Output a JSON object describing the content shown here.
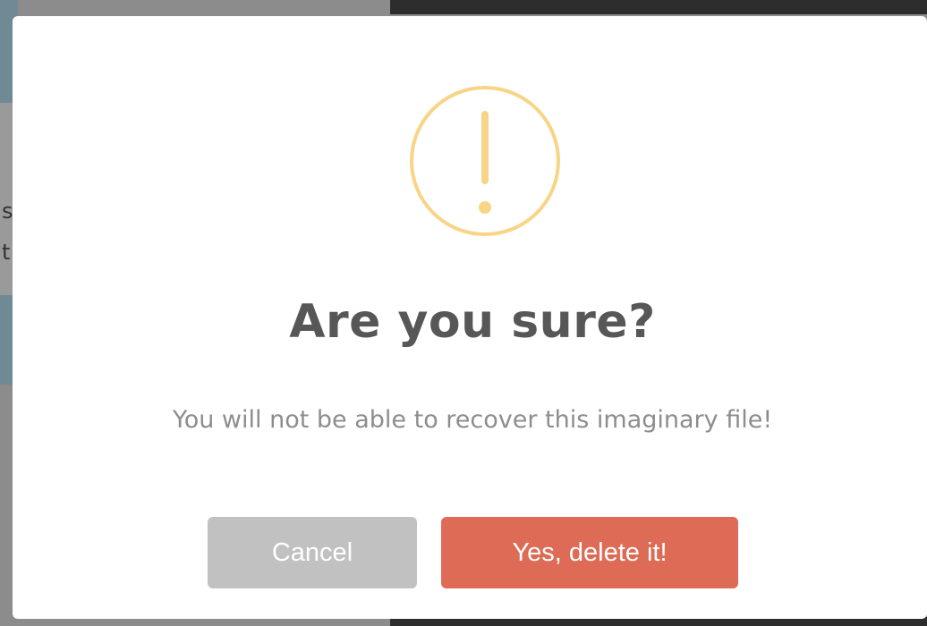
{
  "dialog": {
    "title": "Are you sure?",
    "message": "You will not be able to recover this imaginary file!",
    "icon": "warning-icon",
    "icon_color": "#f8d486",
    "cancel_label": "Cancel",
    "confirm_label": "Yes, delete it!",
    "cancel_color": "#c1c1c1",
    "confirm_color": "#dd6b55"
  },
  "background": {
    "partial_text_1": "s",
    "partial_text_2": "t"
  }
}
